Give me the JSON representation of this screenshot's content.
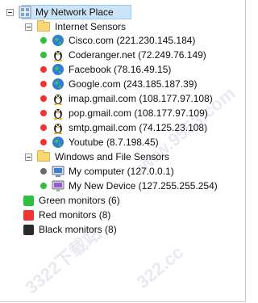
{
  "tree": {
    "root": {
      "label": "My Network Place",
      "icon": "network-place-icon"
    },
    "internet_group": {
      "label": "Internet Sensors",
      "icon": "folder-icon"
    },
    "internet_items": [
      {
        "label": "Cisco.com (221.230.145.184)",
        "status": "green",
        "icon": "globe-icon"
      },
      {
        "label": "Coderanger.net (72.249.76.149)",
        "status": "green",
        "icon": "linux-tux-icon"
      },
      {
        "label": "Facebook (78.16.49.15)",
        "status": "red",
        "icon": "globe-icon"
      },
      {
        "label": "Google.com (243.185.187.39)",
        "status": "red",
        "icon": "globe-icon"
      },
      {
        "label": "imap.gmail.com (108.177.97.108)",
        "status": "red",
        "icon": "linux-tux-icon"
      },
      {
        "label": "pop.gmail.com (108.177.97.109)",
        "status": "red",
        "icon": "linux-tux-icon"
      },
      {
        "label": "smtp.gmail.com (74.125.23.108)",
        "status": "red",
        "icon": "linux-tux-icon"
      },
      {
        "label": "Youtube (8.7.198.45)",
        "status": "red",
        "icon": "globe-icon"
      }
    ],
    "windows_group": {
      "label": "Windows and File Sensors",
      "icon": "folder-icon"
    },
    "windows_items": [
      {
        "label": "My computer (127.0.0.1)",
        "status": "gray",
        "icon": "computer-icon"
      },
      {
        "label": "My New Device (127.255.255.254)",
        "status": "green",
        "icon": "mac-device-icon"
      }
    ]
  },
  "legend": [
    {
      "label": "Green monitors (6)",
      "color": "#2fc13e"
    },
    {
      "label": "Red monitors (8)",
      "color": "#ee3434"
    },
    {
      "label": "Black monitors (8)",
      "color": "#2b2b2b"
    }
  ],
  "watermark": [
    "www.9553.com",
    "3322下载站",
    "322.cc"
  ],
  "colors": {
    "green": "#2fc13e",
    "red": "#ee3434",
    "gray": "#6b6b6b",
    "selection": "#cce4f7"
  }
}
